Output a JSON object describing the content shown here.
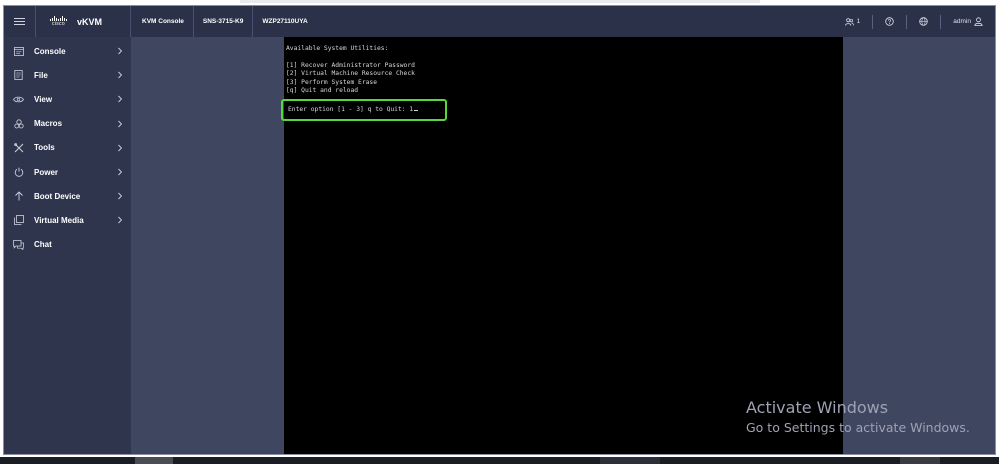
{
  "header": {
    "brand_logo": "cisco",
    "brand_name": "vKVM",
    "breadcrumbs": [
      "KVM Console",
      "SNS-3715-K9",
      "WZP27110UYA"
    ],
    "users_count": "1",
    "user_label": "admin",
    "icons": [
      "menu-icon",
      "users-icon",
      "help-icon",
      "globe-icon",
      "user-icon"
    ]
  },
  "sidebar": {
    "items": [
      {
        "label": "Console",
        "icon": "console-icon",
        "has_submenu": true
      },
      {
        "label": "File",
        "icon": "file-icon",
        "has_submenu": true
      },
      {
        "label": "View",
        "icon": "eye-icon",
        "has_submenu": true
      },
      {
        "label": "Macros",
        "icon": "keyboard-icon",
        "has_submenu": true
      },
      {
        "label": "Tools",
        "icon": "tools-icon",
        "has_submenu": true
      },
      {
        "label": "Power",
        "icon": "power-icon",
        "has_submenu": true
      },
      {
        "label": "Boot Device",
        "icon": "arrow-up-icon",
        "has_submenu": true
      },
      {
        "label": "Virtual Media",
        "icon": "virtual-media-icon",
        "has_submenu": true
      },
      {
        "label": "Chat",
        "icon": "chat-icon",
        "has_submenu": false
      }
    ]
  },
  "console": {
    "title": "Available System Utilities:",
    "options": [
      "[1] Recover Administrator Password",
      "[2] Virtual Machine Resource Check",
      "[3] Perform System Erase",
      "[q] Quit and reload"
    ],
    "prompt": "Enter option [1 - 3] q to Quit: 1",
    "highlight_color": "#55d83b"
  },
  "watermark": {
    "line1": "Activate Windows",
    "line2": "Go to Settings to activate Windows."
  },
  "colors": {
    "header_bg": "#2b3148",
    "sidebar_bg": "#2f354d",
    "content_bg": "#3f4660",
    "console_bg": "#000000"
  }
}
